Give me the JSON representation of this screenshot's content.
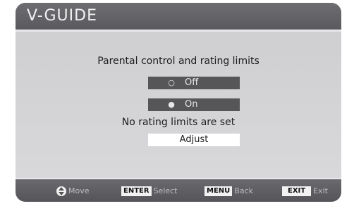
{
  "header": {
    "title": "V-GUIDE"
  },
  "main": {
    "title": "Parental control and rating limits",
    "options": [
      {
        "label": "Off",
        "selected": false
      },
      {
        "label": "On",
        "selected": true
      }
    ],
    "status": "No rating limits are set",
    "adjust_label": "Adjust"
  },
  "footer": {
    "move": {
      "icon": "up-down-arrow-icon",
      "label": "Move"
    },
    "enter": {
      "key": "ENTER",
      "label": "Select"
    },
    "menu": {
      "key": "MENU",
      "label": "Back"
    },
    "exit": {
      "key": "EXIT",
      "label": "Exit"
    }
  },
  "colors": {
    "panel": "#d2d2d4",
    "header": "#5e5e62",
    "option_bg": "#565659",
    "adjust_bg": "#ffffff"
  }
}
